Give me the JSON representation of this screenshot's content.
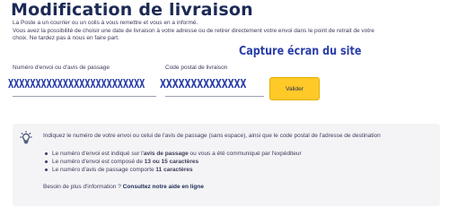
{
  "title": "Modification de livraison",
  "intro": {
    "line1": "La Poste a un courrier ou un colis à vous remettre et vous en a informé.",
    "line2": "Vous avez la possibilité de choisir une date de livraison à votre adresse ou de retirer directement votre envoi dans le point de retrait de votre",
    "line3": "choix. Ne tardez pas à nous en faire part."
  },
  "capture_note": "Capture écran du site",
  "form": {
    "tracking_label": "Numéro d'envoi ou d'avis de passage",
    "tracking_value": "XXXXXXXXXXXXXXXXXXXXXXXXX",
    "postal_label": "Code postal de livraison",
    "postal_value": "XXXXXXXXXXXXXX",
    "submit_label": "Valider"
  },
  "info": {
    "main": "Indiquez le numéro de votre envoi ou celui de l'avis de passage (sans espace), ainsi que le code postal de l'adresse de destination",
    "bullet1_pre": "Le numéro d'envoi est indiqué sur l'",
    "bullet1_bold": "avis de passage",
    "bullet1_post": " ou vous a été communiqué par l'expéditeur",
    "bullet2_pre": "Le numéro d'envoi est composé de ",
    "bullet2_bold": "13 ou 15 caractères",
    "bullet3_pre": "Le numéro d'avis de passage comporte ",
    "bullet3_bold": "11 caractères",
    "more_text": "Besoin de plus d'information ? ",
    "more_link": "Consultez notre aide en ligne"
  },
  "icons": {
    "info_icon": "lightbulb-icon"
  },
  "colors": {
    "title": "#1c2a55",
    "button": "#ffc928",
    "annotation": "#2a3ea8",
    "panel": "#f4f4f6"
  }
}
